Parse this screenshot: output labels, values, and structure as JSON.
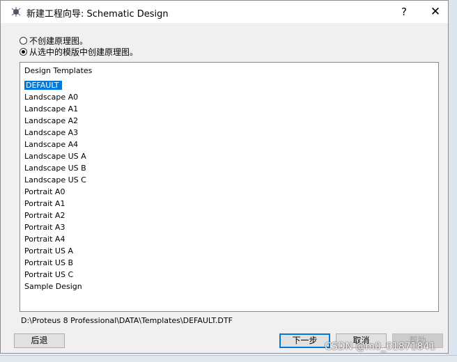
{
  "window": {
    "title": "新建工程向导: Schematic Design",
    "help_label": "?",
    "close_label": "✕"
  },
  "options": {
    "no_schematic": "不创建原理图。",
    "from_template": "从选中的模版中创建原理图。",
    "selected": "from_template"
  },
  "templates": {
    "header": "Design Templates",
    "items": [
      "DEFAULT",
      "Landscape A0",
      "Landscape A1",
      "Landscape A2",
      "Landscape A3",
      "Landscape A4",
      "Landscape US A",
      "Landscape US B",
      "Landscape US C",
      "Portrait A0",
      "Portrait A1",
      "Portrait A2",
      "Portrait A3",
      "Portrait A4",
      "Portrait US A",
      "Portrait US B",
      "Portrait US C",
      "Sample Design"
    ],
    "selected_item": "DEFAULT"
  },
  "path": "D:\\Proteus 8 Professional\\DATA\\Templates\\DEFAULT.DTF",
  "buttons": {
    "back": "后退",
    "next": "下一步",
    "cancel": "取消",
    "help": "帮助"
  },
  "watermark": "CSDN @m0_61871841"
}
